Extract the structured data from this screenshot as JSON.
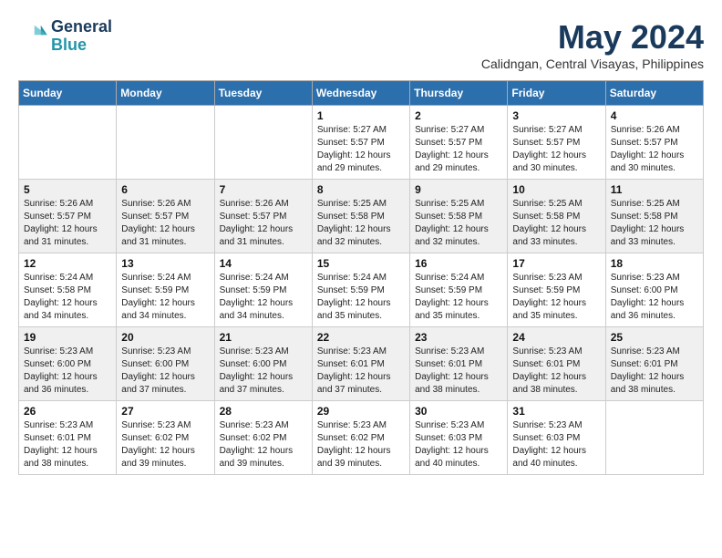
{
  "header": {
    "logo_line1": "General",
    "logo_line2": "Blue",
    "month": "May 2024",
    "location": "Calidngan, Central Visayas, Philippines"
  },
  "days_of_week": [
    "Sunday",
    "Monday",
    "Tuesday",
    "Wednesday",
    "Thursday",
    "Friday",
    "Saturday"
  ],
  "weeks": [
    [
      {
        "day": "",
        "info": ""
      },
      {
        "day": "",
        "info": ""
      },
      {
        "day": "",
        "info": ""
      },
      {
        "day": "1",
        "info": "Sunrise: 5:27 AM\nSunset: 5:57 PM\nDaylight: 12 hours\nand 29 minutes."
      },
      {
        "day": "2",
        "info": "Sunrise: 5:27 AM\nSunset: 5:57 PM\nDaylight: 12 hours\nand 29 minutes."
      },
      {
        "day": "3",
        "info": "Sunrise: 5:27 AM\nSunset: 5:57 PM\nDaylight: 12 hours\nand 30 minutes."
      },
      {
        "day": "4",
        "info": "Sunrise: 5:26 AM\nSunset: 5:57 PM\nDaylight: 12 hours\nand 30 minutes."
      }
    ],
    [
      {
        "day": "5",
        "info": "Sunrise: 5:26 AM\nSunset: 5:57 PM\nDaylight: 12 hours\nand 31 minutes."
      },
      {
        "day": "6",
        "info": "Sunrise: 5:26 AM\nSunset: 5:57 PM\nDaylight: 12 hours\nand 31 minutes."
      },
      {
        "day": "7",
        "info": "Sunrise: 5:26 AM\nSunset: 5:57 PM\nDaylight: 12 hours\nand 31 minutes."
      },
      {
        "day": "8",
        "info": "Sunrise: 5:25 AM\nSunset: 5:58 PM\nDaylight: 12 hours\nand 32 minutes."
      },
      {
        "day": "9",
        "info": "Sunrise: 5:25 AM\nSunset: 5:58 PM\nDaylight: 12 hours\nand 32 minutes."
      },
      {
        "day": "10",
        "info": "Sunrise: 5:25 AM\nSunset: 5:58 PM\nDaylight: 12 hours\nand 33 minutes."
      },
      {
        "day": "11",
        "info": "Sunrise: 5:25 AM\nSunset: 5:58 PM\nDaylight: 12 hours\nand 33 minutes."
      }
    ],
    [
      {
        "day": "12",
        "info": "Sunrise: 5:24 AM\nSunset: 5:58 PM\nDaylight: 12 hours\nand 34 minutes."
      },
      {
        "day": "13",
        "info": "Sunrise: 5:24 AM\nSunset: 5:59 PM\nDaylight: 12 hours\nand 34 minutes."
      },
      {
        "day": "14",
        "info": "Sunrise: 5:24 AM\nSunset: 5:59 PM\nDaylight: 12 hours\nand 34 minutes."
      },
      {
        "day": "15",
        "info": "Sunrise: 5:24 AM\nSunset: 5:59 PM\nDaylight: 12 hours\nand 35 minutes."
      },
      {
        "day": "16",
        "info": "Sunrise: 5:24 AM\nSunset: 5:59 PM\nDaylight: 12 hours\nand 35 minutes."
      },
      {
        "day": "17",
        "info": "Sunrise: 5:23 AM\nSunset: 5:59 PM\nDaylight: 12 hours\nand 35 minutes."
      },
      {
        "day": "18",
        "info": "Sunrise: 5:23 AM\nSunset: 6:00 PM\nDaylight: 12 hours\nand 36 minutes."
      }
    ],
    [
      {
        "day": "19",
        "info": "Sunrise: 5:23 AM\nSunset: 6:00 PM\nDaylight: 12 hours\nand 36 minutes."
      },
      {
        "day": "20",
        "info": "Sunrise: 5:23 AM\nSunset: 6:00 PM\nDaylight: 12 hours\nand 37 minutes."
      },
      {
        "day": "21",
        "info": "Sunrise: 5:23 AM\nSunset: 6:00 PM\nDaylight: 12 hours\nand 37 minutes."
      },
      {
        "day": "22",
        "info": "Sunrise: 5:23 AM\nSunset: 6:01 PM\nDaylight: 12 hours\nand 37 minutes."
      },
      {
        "day": "23",
        "info": "Sunrise: 5:23 AM\nSunset: 6:01 PM\nDaylight: 12 hours\nand 38 minutes."
      },
      {
        "day": "24",
        "info": "Sunrise: 5:23 AM\nSunset: 6:01 PM\nDaylight: 12 hours\nand 38 minutes."
      },
      {
        "day": "25",
        "info": "Sunrise: 5:23 AM\nSunset: 6:01 PM\nDaylight: 12 hours\nand 38 minutes."
      }
    ],
    [
      {
        "day": "26",
        "info": "Sunrise: 5:23 AM\nSunset: 6:01 PM\nDaylight: 12 hours\nand 38 minutes."
      },
      {
        "day": "27",
        "info": "Sunrise: 5:23 AM\nSunset: 6:02 PM\nDaylight: 12 hours\nand 39 minutes."
      },
      {
        "day": "28",
        "info": "Sunrise: 5:23 AM\nSunset: 6:02 PM\nDaylight: 12 hours\nand 39 minutes."
      },
      {
        "day": "29",
        "info": "Sunrise: 5:23 AM\nSunset: 6:02 PM\nDaylight: 12 hours\nand 39 minutes."
      },
      {
        "day": "30",
        "info": "Sunrise: 5:23 AM\nSunset: 6:03 PM\nDaylight: 12 hours\nand 40 minutes."
      },
      {
        "day": "31",
        "info": "Sunrise: 5:23 AM\nSunset: 6:03 PM\nDaylight: 12 hours\nand 40 minutes."
      },
      {
        "day": "",
        "info": ""
      }
    ]
  ]
}
